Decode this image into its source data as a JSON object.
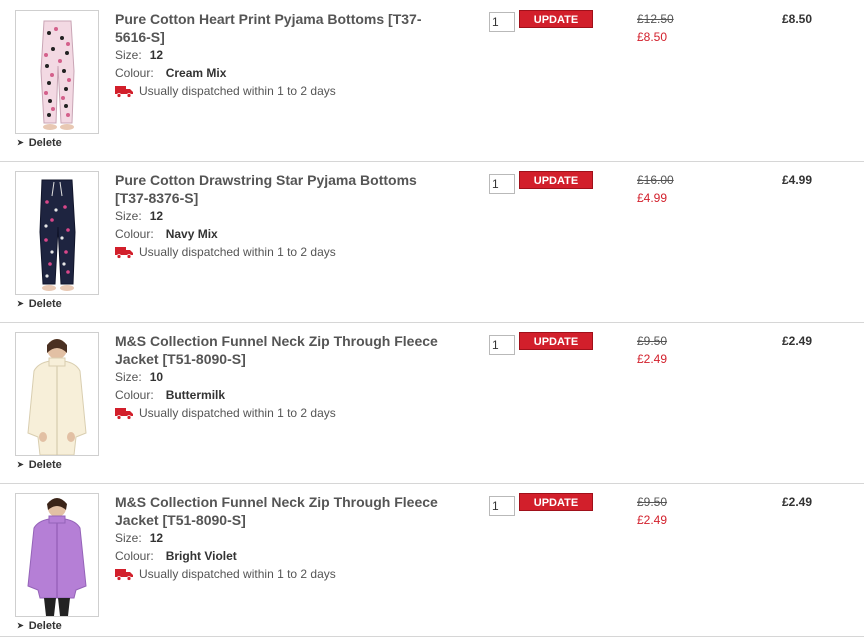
{
  "basket": {
    "items": [
      {
        "title": "Pure Cotton Heart Print Pyjama Bottoms [T37-5616-S]",
        "title_line1": "Pure Cotton Heart Print Pyjama Bottoms [T37-",
        "title_line2": "5616-S]",
        "size_label": "Size:",
        "size": "12",
        "colour_label": "Colour:",
        "colour": "Cream Mix",
        "dispatch": "Usually dispatched within 1 to 2 days",
        "quantity": "1",
        "update_label": "UPDATE",
        "was_price": "£12.50",
        "now_price": "£8.50",
        "total": "£8.50",
        "delete_label": "Delete",
        "image_icon": "pyjama-bottoms-heart-print-image"
      },
      {
        "title": "Pure Cotton Drawstring Star Pyjama Bottoms [T37-8376-S]",
        "title_line1": "Pure Cotton Drawstring Star Pyjama Bottoms",
        "title_line2": "[T37-8376-S]",
        "size_label": "Size:",
        "size": "12",
        "colour_label": "Colour:",
        "colour": "Navy Mix",
        "dispatch": "Usually dispatched within 1 to 2 days",
        "quantity": "1",
        "update_label": "UPDATE",
        "was_price": "£16.00",
        "now_price": "£4.99",
        "total": "£4.99",
        "delete_label": "Delete",
        "image_icon": "pyjama-bottoms-star-print-image"
      },
      {
        "title": "M&S Collection Funnel Neck Zip Through Fleece Jacket [T51-8090-S]",
        "title_line1": "M&S Collection Funnel Neck Zip Through Fleece",
        "title_line2": "Jacket [T51-8090-S]",
        "size_label": "Size:",
        "size": "10",
        "colour_label": "Colour:",
        "colour": "Buttermilk",
        "dispatch": "Usually dispatched within 1 to 2 days",
        "quantity": "1",
        "update_label": "UPDATE",
        "was_price": "£9.50",
        "now_price": "£2.49",
        "total": "£2.49",
        "delete_label": "Delete",
        "image_icon": "fleece-jacket-buttermilk-image"
      },
      {
        "title": "M&S Collection Funnel Neck Zip Through Fleece Jacket [T51-8090-S]",
        "title_line1": "M&S Collection Funnel Neck Zip Through Fleece",
        "title_line2": "Jacket [T51-8090-S]",
        "size_label": "Size:",
        "size": "12",
        "colour_label": "Colour:",
        "colour": "Bright Violet",
        "dispatch": "Usually dispatched within 1 to 2 days",
        "quantity": "1",
        "update_label": "UPDATE",
        "was_price": "£9.50",
        "now_price": "£2.49",
        "total": "£2.49",
        "delete_label": "Delete",
        "image_icon": "fleece-jacket-violet-image"
      }
    ]
  },
  "colors": {
    "accent_red": "#d21f2b",
    "text": "#333333",
    "divider": "#d6d6d6"
  },
  "icons": {
    "dispatch": "delivery-truck-icon",
    "delete": "arrow-right-icon"
  }
}
